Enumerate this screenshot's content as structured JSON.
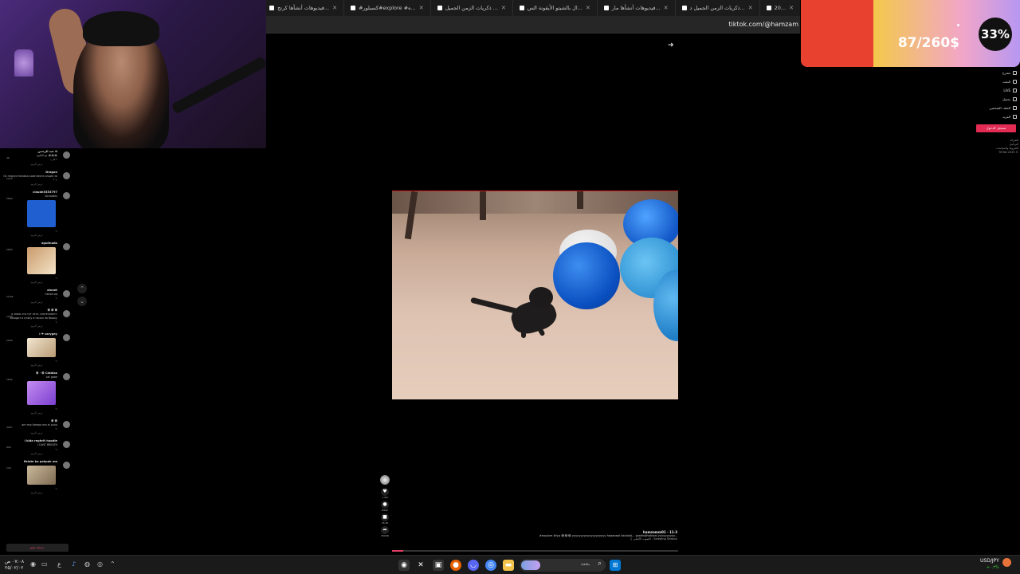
{
  "browser": {
    "tabs": [
      {
        "label": "20..."
      },
      {
        "label": "ذكريات الزمن الجميل د..."
      },
      {
        "label": "فيديوهات أنشأها مار..."
      },
      {
        "label": "ال بالشيتو الأيقونة الس..."
      },
      {
        "label": "ذكريات الزمن الجميل ..."
      },
      {
        "label": "#كسبلور#explore #ه..."
      },
      {
        "label": "فيديوهات أنشأها كرنج..."
      },
      {
        "label": "ذكريات الزمن الجميل"
      }
    ],
    "url": "tiktok.com/@hamzam"
  },
  "donation_goal": {
    "amount": "87/260$",
    "percent_label": "33%",
    "progress": 0.33,
    "colors": {
      "fill": "#e8412f",
      "rest": "#f3c94b"
    }
  },
  "comments": [
    {
      "name": "عبد الرحمن ✿",
      "text": "مع البالون 😂😂😂",
      "meta": "٣ ✿ رد",
      "likes": "46"
    },
    {
      "name": "Dragon",
      "text": "Ох переустановка комплекта опция за",
      "meta": "1 رد",
      "likes": "1220"
    },
    {
      "name": "claude5353797",
      "text": "Da bobes",
      "meta": "رد",
      "likes": "2862"
    },
    {
      "name": "aguilnada",
      "text": "",
      "meta": "رد",
      "likes": "2860"
    },
    {
      "name": "ahmet",
      "text": "hahah.aq",
      "meta": "رد",
      "likes": "29.6K"
    },
    {
      "name": "ꕥ ꕥ ꕥ",
      "text": "а знаю что тут есть «интеллект» заходит в атаку и начал на бошку",
      "meta": "رد",
      "likes": "1008"
    },
    {
      "name": "i ❤ carygey",
      "text": "",
      "meta": "رد",
      "likes": "2990"
    },
    {
      "name": "ꕥ · ꕥ Catdias",
      "text": "cat gabe",
      "meta": "رد",
      "likes": "1802"
    },
    {
      "name": "ꕥ ꕥ",
      "text": "am mix tiempo era el ouno",
      "meta": "رد",
      "likes": "3997"
    },
    {
      "name": "i kida reghrit hoodie",
      "text": "I CANT BREATH",
      "meta": "رد",
      "likes": "890"
    },
    {
      "name": "fisiote ka pakpak ma",
      "text": "",
      "meta": "رد",
      "likes": "130"
    }
  ],
  "replies_label": "عرض الردود",
  "add_comment": "إضافة تعليق...",
  "actions": [
    {
      "icon": "heart-icon",
      "glyph": "♥",
      "count": "1.5M"
    },
    {
      "icon": "comment-icon",
      "glyph": "●",
      "count": "6942"
    },
    {
      "icon": "bookmark-icon",
      "glyph": "■",
      "count": "76.3K"
    },
    {
      "icon": "share-icon",
      "glyph": "➦",
      "count": "25048"
    }
  ],
  "caption": {
    "user": "hamzamm01 · 11-3",
    "description": "#explore #fyp 😂😂😂 yyyyyyyyyyyyyyyyyyyy haaaaaal lolololol... pyshkdjhahlaal yyyyyyyyyy...",
    "music": "♫ الصوت الأصلي - Sleeping Season"
  },
  "right_nav": [
    {
      "label": "مقترح"
    },
    {
      "label": "البحث"
    },
    {
      "label": "LIVE"
    },
    {
      "label": "تحميل"
    },
    {
      "label": "الملف الشخصي"
    },
    {
      "label": "المزيد"
    }
  ],
  "login_label": "تسجيل الدخول",
  "footer_lines": [
    "الشركة",
    "البرنامج",
    "الشروط والسياسات",
    "TikTok 2025 ©"
  ],
  "taskbar": {
    "clock_time": "٠٧:٠٨ ص",
    "clock_date": "٢٥/٠٢/٠٢",
    "search_placeholder": "بحث",
    "currency": "USD/JPY",
    "currency_change": "+٠.٣%"
  }
}
